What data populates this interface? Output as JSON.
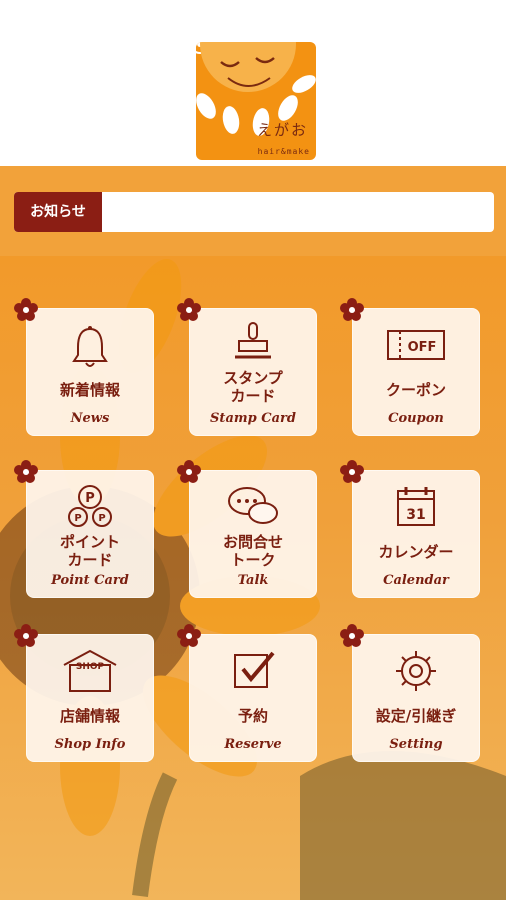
{
  "logo": {
    "text_jp": "えがお",
    "text_en": "hair&make"
  },
  "notice": {
    "label": "お知らせ",
    "text": ""
  },
  "menu": [
    {
      "jp": "新着情報",
      "en": "News",
      "icon": "bell-icon"
    },
    {
      "jp": "スタンプ\nカード",
      "en": "Stamp Card",
      "icon": "stamp-icon"
    },
    {
      "jp": "クーポン",
      "en": "Coupon",
      "icon": "coupon-icon"
    },
    {
      "jp": "ポイント\nカード",
      "en": "Point Card",
      "icon": "point-icon"
    },
    {
      "jp": "お問合せ\nトーク",
      "en": "Talk",
      "icon": "chat-icon"
    },
    {
      "jp": "カレンダー",
      "en": "Calendar",
      "icon": "calendar-icon"
    },
    {
      "jp": "店舗情報",
      "en": "Shop Info",
      "icon": "shop-icon"
    },
    {
      "jp": "予約",
      "en": "Reserve",
      "icon": "checkbox-icon"
    },
    {
      "jp": "設定/引継ぎ",
      "en": "Setting",
      "icon": "gear-icon"
    }
  ],
  "icon_labels": {
    "coupon": "OFF",
    "calendar_day": "31",
    "shop": "SHOP",
    "point": "P"
  },
  "colors": {
    "accent": "#8b1e14",
    "orange": "#f39212",
    "tile_text": "#7a1f10"
  }
}
